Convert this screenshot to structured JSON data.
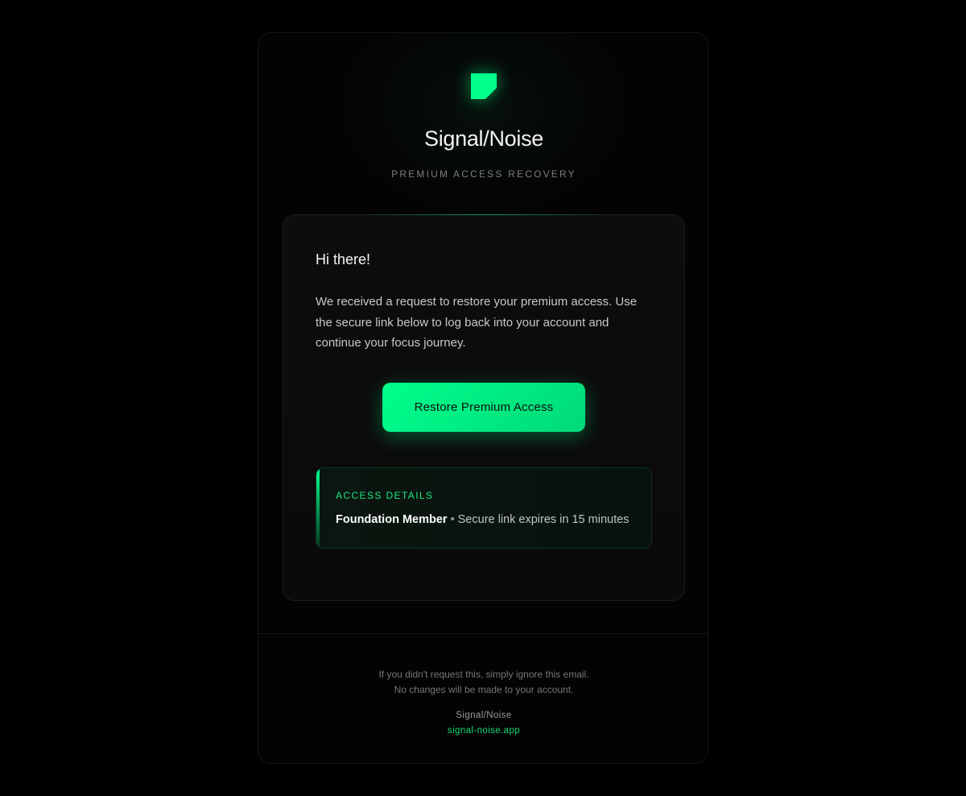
{
  "brand": {
    "logo_icon": "signal-tag-icon",
    "name": "Signal/Noise",
    "subtitle": "PREMIUM ACCESS RECOVERY",
    "accent_color": "#00ff8c"
  },
  "message": {
    "greeting": "Hi there!",
    "body": "We received a request to restore your premium access. Use the secure link below to log back into your account and continue your focus journey.",
    "cta_label": "Restore Premium Access"
  },
  "details": {
    "label": "ACCESS DETAILS",
    "tier": "Foundation Member",
    "separator": "•",
    "expiry": "Secure link expires in 15 minutes"
  },
  "footer": {
    "note_line1": "If you didn't request this, simply ignore this email.",
    "note_line2": "No changes will be made to your account.",
    "brand": "Signal/Noise",
    "link": "signal-noise.app"
  }
}
